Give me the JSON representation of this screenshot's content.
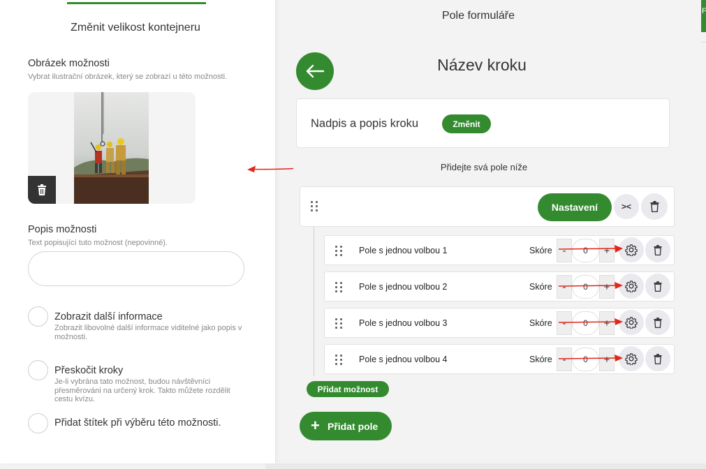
{
  "left_panel": {
    "title": "Změnit velikost kontejneru",
    "image_section": {
      "title": "Obrázek možnosti",
      "subtitle": "Vybrat ilustrační obrázek, který se zobrazí u této možnosti."
    },
    "description_section": {
      "title": "Popis možnosti",
      "subtitle": "Text popisující tuto možnost (nepovinné).",
      "value": "",
      "placeholder": ""
    },
    "options": [
      {
        "label": "Zobrazit další informace",
        "subtext": "Zobrazit libovolné další informace viditelné jako popis v možnosti."
      },
      {
        "label": "Přeskočit kroky",
        "subtext": "Je-li vybrána tato možnost, budou návštěvníci přesměrováni na určený krok. Takto můžete rozdělit cestu kvízu."
      },
      {
        "label": "Přidat štítek při výběru této možnosti.",
        "subtext": ""
      }
    ]
  },
  "main": {
    "title": "Pole formuláře",
    "step_title": "Název kroku",
    "step_card_label": "Nadpis a popis kroku",
    "change_label": "Změnit",
    "add_fields_hint": "Přidejte svá pole níže",
    "settings_label": "Nastavení",
    "collapse_label": "><",
    "score_label": "Skóre",
    "fields": [
      {
        "label": "Pole s jednou volbou 1",
        "score": "0"
      },
      {
        "label": "Pole s jednou volbou 2",
        "score": "0"
      },
      {
        "label": "Pole s jednou volbou 3",
        "score": "0"
      },
      {
        "label": "Pole s jednou volbou 4",
        "score": "0"
      }
    ],
    "stepper_minus": "-",
    "stepper_plus": "+",
    "add_option_label": "Přidat možnost",
    "add_field_label": "Přidat pole",
    "add_field_icon": "+"
  },
  "edge": {
    "letter": "F"
  },
  "icons": {
    "back": "arrow-left-icon",
    "delete": "trash-icon",
    "settings": "gear-icon",
    "drag": "drag-handle-icon",
    "add": "plus-icon"
  },
  "colors": {
    "accent": "#338a2f",
    "annotation_arrow": "#e3261a",
    "background": "#f3f3f3",
    "button_gray": "#e9e9ee"
  }
}
